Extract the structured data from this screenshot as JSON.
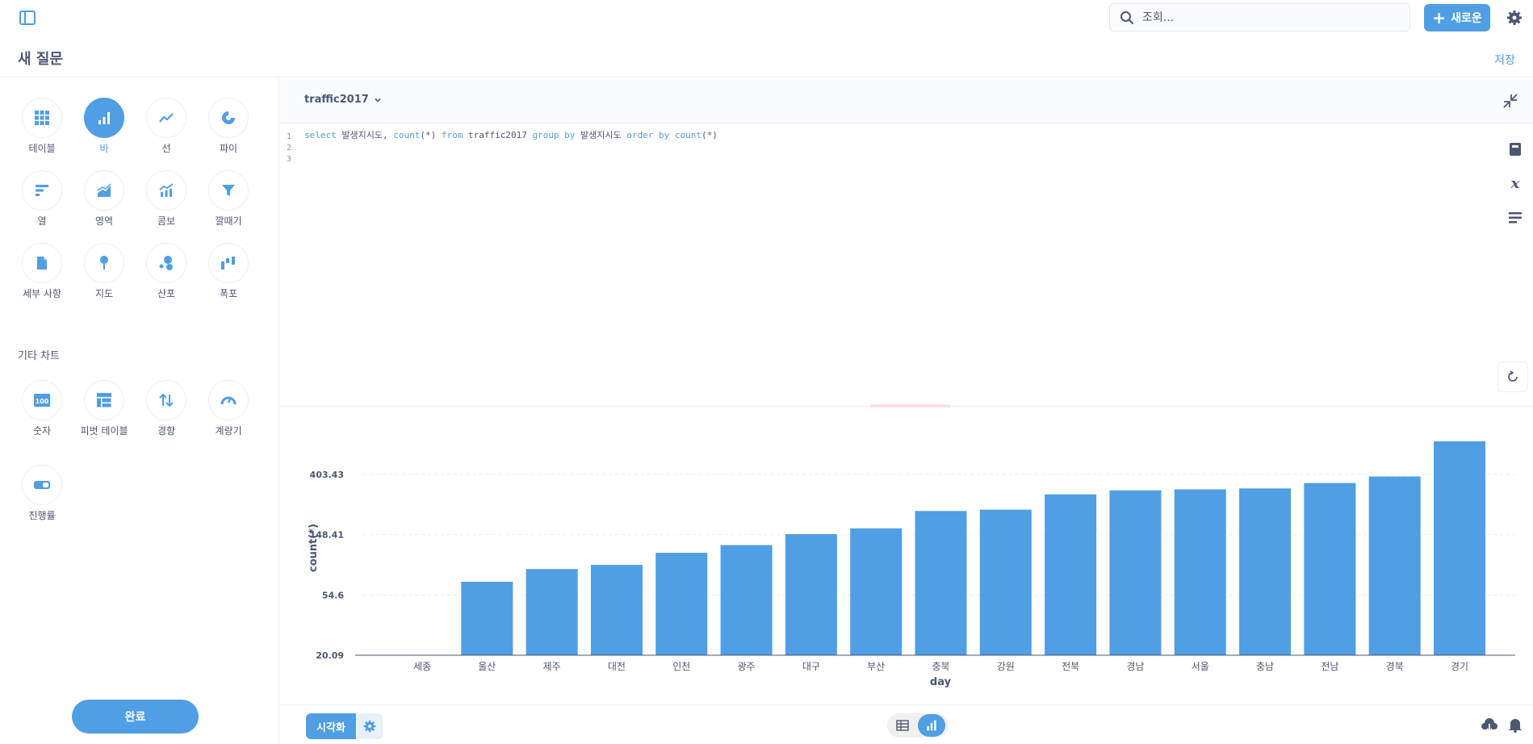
{
  "search": {
    "placeholder": "조회..."
  },
  "nav": {
    "new_label": "새로운"
  },
  "header": {
    "title": "새 질문",
    "save_label": "저장"
  },
  "viz_types": [
    {
      "label": "테이블",
      "icon": "table-icon"
    },
    {
      "label": "바",
      "icon": "bar-icon",
      "active": true
    },
    {
      "label": "선",
      "icon": "line-icon"
    },
    {
      "label": "파이",
      "icon": "pie-icon"
    },
    {
      "label": "열",
      "icon": "row-icon"
    },
    {
      "label": "영역",
      "icon": "area-icon"
    },
    {
      "label": "콤보",
      "icon": "combo-icon"
    },
    {
      "label": "깔때기",
      "icon": "funnel-icon"
    },
    {
      "label": "세부 사항",
      "icon": "detail-icon"
    },
    {
      "label": "지도",
      "icon": "map-pin-icon"
    },
    {
      "label": "산포",
      "icon": "scatter-icon"
    },
    {
      "label": "폭포",
      "icon": "waterfall-icon"
    }
  ],
  "other_charts_label": "기타 차트",
  "other_viz": [
    {
      "label": "숫자",
      "icon": "number-icon",
      "badge": "100"
    },
    {
      "label": "피벗 테이블",
      "icon": "pivot-table-icon"
    },
    {
      "label": "경향",
      "icon": "trend-icon"
    },
    {
      "label": "계량기",
      "icon": "gauge-icon"
    },
    {
      "label": "진행률",
      "icon": "progress-icon"
    }
  ],
  "done_label": "완료",
  "editor": {
    "database": "traffic2017",
    "line_numbers": [
      "1",
      "2",
      "3"
    ],
    "query_parts": [
      {
        "text": "select",
        "kw": true
      },
      {
        "text": " 발생지시도, ",
        "kw": false
      },
      {
        "text": "count",
        "kw": true
      },
      {
        "text": "(*) ",
        "kw": false
      },
      {
        "text": "from",
        "kw": true
      },
      {
        "text": " traffic2017 ",
        "kw": false
      },
      {
        "text": "group by",
        "kw": true
      },
      {
        "text": " 발생지시도 ",
        "kw": false
      },
      {
        "text": "order by",
        "kw": true
      },
      {
        "text": " ",
        "kw": false
      },
      {
        "text": "count",
        "kw": true
      },
      {
        "text": "(*)",
        "kw": false
      }
    ]
  },
  "footer": {
    "viz_button_label": "시각화"
  },
  "colors": {
    "accent": "#509ee3",
    "text": "#4c5773",
    "grid": "#ededed"
  },
  "chart_data": {
    "type": "bar",
    "xlabel": "day",
    "ylabel": "count(*)",
    "y_ticks": [
      "20.09",
      "54.6",
      "148.41",
      "403.43"
    ],
    "y_tick_values": [
      20.09,
      54.6,
      148.41,
      403.43
    ],
    "scale": "log",
    "categories": [
      "세종",
      "울산",
      "제주",
      "대전",
      "인천",
      "광주",
      "대구",
      "부산",
      "충북",
      "강원",
      "전북",
      "경남",
      "서울",
      "충남",
      "전남",
      "경북",
      "경기"
    ],
    "values": [
      20,
      68,
      84,
      90,
      110,
      125,
      150,
      165,
      220,
      225,
      290,
      310,
      315,
      320,
      350,
      390,
      700
    ]
  }
}
